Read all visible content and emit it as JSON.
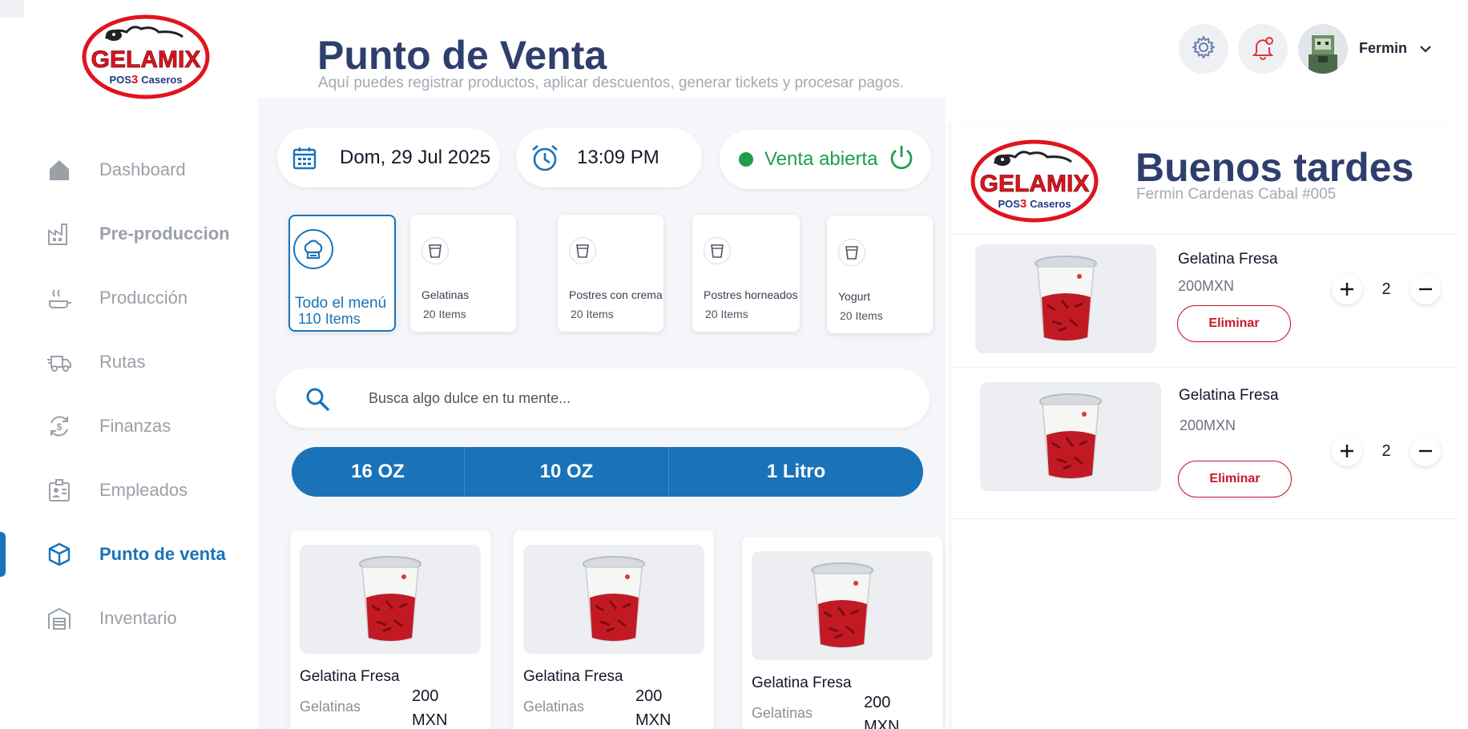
{
  "brand": {
    "name": "GELAMIX",
    "tagline_pos": "POS",
    "tagline_3": "3",
    "tagline_caseros": "Caseros"
  },
  "sidebar": {
    "items": [
      {
        "label": "Dashboard",
        "icon": "home-icon"
      },
      {
        "label": "Pre-produccion",
        "icon": "factory-icon"
      },
      {
        "label": "Producción",
        "icon": "cooking-pan-icon"
      },
      {
        "label": "Rutas",
        "icon": "delivery-truck-icon"
      },
      {
        "label": "Finanzas",
        "icon": "finance-cycle-icon"
      },
      {
        "label": "Empleados",
        "icon": "employee-badge-icon"
      },
      {
        "label": "Punto de venta",
        "icon": "box-icon",
        "active": true
      },
      {
        "label": "Inventario",
        "icon": "warehouse-icon"
      }
    ]
  },
  "header": {
    "title": "Punto de Venta",
    "subtitle": "Aquí puedes registrar productos, aplicar descuentos, generar tickets y procesar pagos.",
    "user_name": "Fermin"
  },
  "status_bar": {
    "date": "Dom, 29 Jul 2025",
    "time": "13:09 PM",
    "sale_status": "Venta abierta"
  },
  "categories": [
    {
      "name": "Todo el menú",
      "count": "110 Items",
      "selected": true
    },
    {
      "name": "Gelatinas",
      "count": "20 Items"
    },
    {
      "name": "Postres con crema",
      "count": "20 Items"
    },
    {
      "name": "Postres horneados",
      "count": "20 Items"
    },
    {
      "name": "Yogurt",
      "count": "20 Items"
    }
  ],
  "search": {
    "placeholder": "Busca algo dulce en tu mente..."
  },
  "sizes": [
    "16 OZ",
    "10 OZ",
    "1 Litro"
  ],
  "products": [
    {
      "name": "Gelatina Fresa",
      "category": "Gelatinas",
      "price_amount": "200",
      "price_currency": "MXN"
    },
    {
      "name": "Gelatina Fresa",
      "category": "Gelatinas",
      "price_amount": "200",
      "price_currency": "MXN"
    },
    {
      "name": "Gelatina Fresa",
      "category": "Gelatinas",
      "price_amount": "200",
      "price_currency": "MXN"
    }
  ],
  "cart": {
    "greeting": "Buenos tardes",
    "cashier": "Fermin Cardenas Cabal #005",
    "items": [
      {
        "name": "Gelatina Fresa",
        "price": "200MXN",
        "qty": "2",
        "remove_label": "Eliminar"
      },
      {
        "name": "Gelatina Fresa",
        "price": "200MXN",
        "qty": "2",
        "remove_label": "Eliminar"
      }
    ]
  },
  "colors": {
    "accent": "#1a73b8",
    "title": "#2e3f6e",
    "success": "#1e9e4a",
    "danger": "#c9182b",
    "brand_red": "#e0141e"
  }
}
